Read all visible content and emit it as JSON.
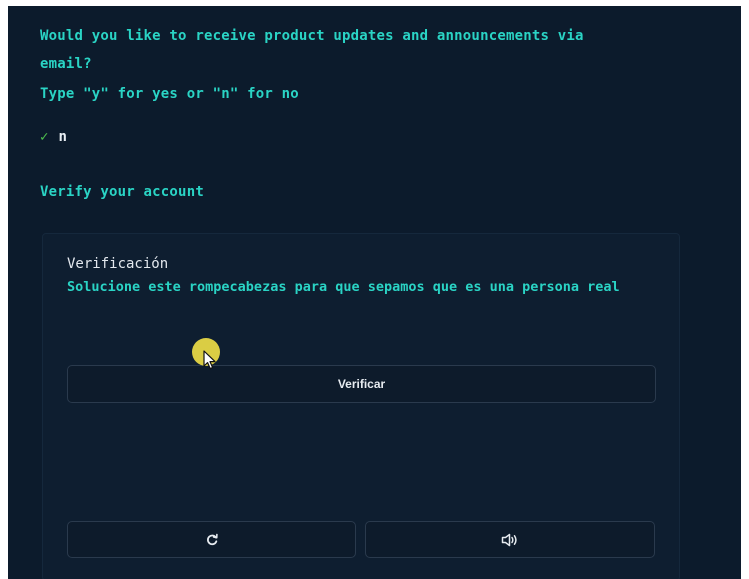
{
  "terminal": {
    "question_line1": "Would you like to receive product updates and announcements via",
    "question_line2": "email?",
    "instruction": "Type \"y\" for yes or \"n\" for no",
    "check_icon": "✓",
    "answer": "n",
    "section_heading": "Verify your account"
  },
  "verification": {
    "title": "Verificación",
    "description": "Solucione este rompecabezas para que sepamos que es una persona real",
    "verify_button": "Verificar",
    "reload_icon": "reload-icon",
    "audio_icon": "speaker-icon"
  },
  "colors": {
    "background": "#0c1b2c",
    "accent": "#2ad4c5",
    "check": "#4ec14e",
    "cursor_halo": "#ecdc46"
  }
}
